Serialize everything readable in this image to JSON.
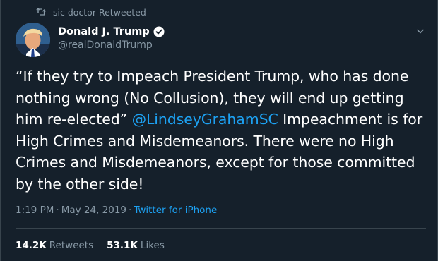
{
  "retweet_banner": {
    "user": "sic doctor",
    "text": "Retweeted",
    "icon": "retweet-icon"
  },
  "author": {
    "name": "Donald J. Trump",
    "handle": "@realDonaldTrump",
    "verified_icon": "verified-badge-icon"
  },
  "tweet": {
    "text_before": "“If they try to Impeach President Trump, who has done nothing wrong (No Collusion), they will end up getting him re-elected” ",
    "mention": "@LindseyGrahamSC",
    "text_after": " Impeachment is for High Crimes and Misdemeanors. There were no High Crimes and Misdemeanors, except for those committed by the other side!"
  },
  "meta": {
    "time": "1:19 PM",
    "separator1": "·",
    "date": "May 24, 2019",
    "separator2": "·",
    "source": "Twitter for iPhone"
  },
  "stats": {
    "retweets_value": "14.2K",
    "retweets_label": "Retweets",
    "likes_value": "53.1K",
    "likes_label": "Likes"
  },
  "colors": {
    "background": "#15202b",
    "muted": "#8899a6",
    "accent": "#1da1f2",
    "border": "#38444d"
  }
}
